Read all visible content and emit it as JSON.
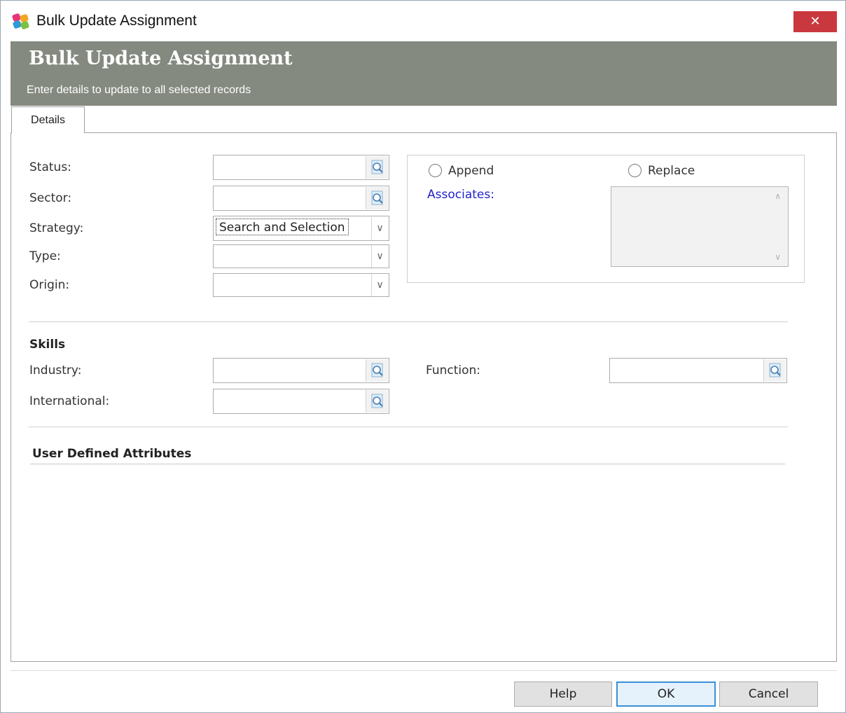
{
  "window": {
    "title": "Bulk Update Assignment",
    "close_label": "✕"
  },
  "header": {
    "title": "Bulk Update Assignment",
    "subtitle": "Enter details to update to all selected records"
  },
  "tabs": [
    {
      "label": "Details"
    }
  ],
  "form": {
    "status": {
      "label": "Status:",
      "value": ""
    },
    "sector": {
      "label": "Sector:",
      "value": ""
    },
    "strategy": {
      "label": "Strategy:",
      "value": "Search and Selection"
    },
    "type": {
      "label": "Type:",
      "value": ""
    },
    "origin": {
      "label": "Origin:",
      "value": ""
    }
  },
  "associates": {
    "append_label": "Append",
    "replace_label": "Replace",
    "append_selected": false,
    "replace_selected": false,
    "label": "Associates:",
    "label_color": "#2222cc"
  },
  "skills": {
    "title": "Skills",
    "industry": {
      "label": "Industry:",
      "value": ""
    },
    "international": {
      "label": "International:",
      "value": ""
    },
    "function": {
      "label": "Function:",
      "value": ""
    }
  },
  "user_defined": {
    "title": "User Defined Attributes"
  },
  "buttons": {
    "help": "Help",
    "ok": "OK",
    "cancel": "Cancel"
  },
  "colors": {
    "header_bg": "#858a80",
    "close_bg": "#c9383e",
    "ok_border": "#3c8fd8"
  },
  "icons": {
    "lookup": "magnifier-icon",
    "dropdown": "chevron-down-icon",
    "app": "app-logo-icon"
  }
}
